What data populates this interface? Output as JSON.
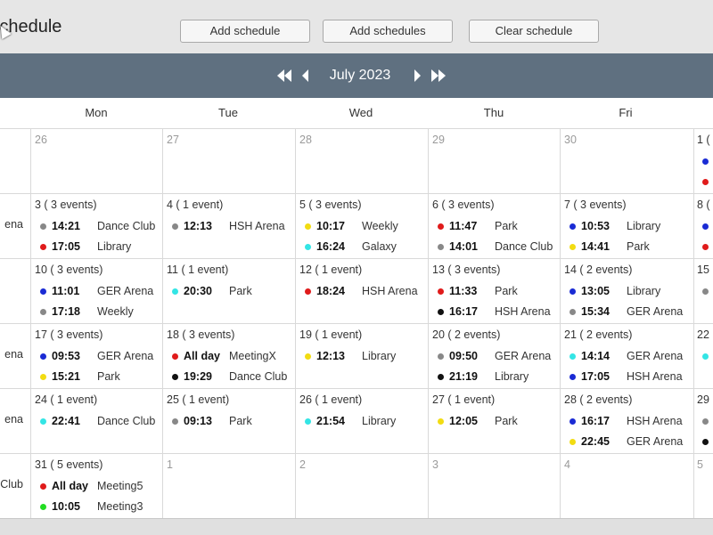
{
  "app": {
    "title": "Schedule"
  },
  "toolbar": {
    "add_label": "Add schedule",
    "add_multi_label": "Add schedules",
    "clear_label": "Clear schedule"
  },
  "nav": {
    "month_label": "July 2023"
  },
  "colors": {
    "nav_bg": "#5f7080",
    "blue": "#1a2bd4",
    "red": "#e01b1b",
    "gray": "#888888",
    "yellow": "#f2dc12",
    "cyan": "#33e5e5",
    "black": "#111111",
    "green": "#22dd22"
  },
  "weekdays": [
    "Mon",
    "Tue",
    "Wed",
    "Thu",
    "Fri"
  ],
  "weeks": [
    [
      {
        "date": "26",
        "muted": true,
        "events": []
      },
      {
        "date": "27",
        "muted": true,
        "events": []
      },
      {
        "date": "28",
        "muted": true,
        "events": []
      },
      {
        "date": "29",
        "muted": true,
        "events": []
      },
      {
        "date": "30",
        "muted": true,
        "events": []
      }
    ],
    [
      {
        "date": "3 ( 3 events)",
        "events": [
          {
            "color": "gray",
            "time": "14:21",
            "title": "Dance Club"
          },
          {
            "color": "red",
            "time": "17:05",
            "title": "Library"
          }
        ]
      },
      {
        "date": "4 ( 1 event)",
        "events": [
          {
            "color": "gray",
            "time": "12:13",
            "title": "HSH Arena"
          }
        ]
      },
      {
        "date": "5 ( 3 events)",
        "events": [
          {
            "color": "yellow",
            "time": "10:17",
            "title": "Weekly"
          },
          {
            "color": "cyan",
            "time": "16:24",
            "title": "Galaxy"
          }
        ]
      },
      {
        "date": "6 ( 3 events)",
        "events": [
          {
            "color": "red",
            "time": "11:47",
            "title": "Park"
          },
          {
            "color": "gray",
            "time": "14:01",
            "title": "Dance Club"
          }
        ]
      },
      {
        "date": "7 ( 3 events)",
        "events": [
          {
            "color": "blue",
            "time": "10:53",
            "title": "Library"
          },
          {
            "color": "yellow",
            "time": "14:41",
            "title": "Park"
          }
        ]
      }
    ],
    [
      {
        "date": "10 ( 3 events)",
        "events": [
          {
            "color": "blue",
            "time": "11:01",
            "title": "GER Arena"
          },
          {
            "color": "gray",
            "time": "17:18",
            "title": "Weekly"
          }
        ]
      },
      {
        "date": "11 ( 1 event)",
        "events": [
          {
            "color": "cyan",
            "time": "20:30",
            "title": "Park"
          }
        ]
      },
      {
        "date": "12 ( 1 event)",
        "events": [
          {
            "color": "red",
            "time": "18:24",
            "title": "HSH Arena"
          }
        ]
      },
      {
        "date": "13 ( 3 events)",
        "events": [
          {
            "color": "red",
            "time": "11:33",
            "title": "Park"
          },
          {
            "color": "black",
            "time": "16:17",
            "title": "HSH Arena"
          }
        ]
      },
      {
        "date": "14 ( 2 events)",
        "events": [
          {
            "color": "blue",
            "time": "13:05",
            "title": "Library"
          },
          {
            "color": "gray",
            "time": "15:34",
            "title": "GER Arena"
          }
        ]
      }
    ],
    [
      {
        "date": "17 ( 3 events)",
        "events": [
          {
            "color": "blue",
            "time": "09:53",
            "title": "GER Arena"
          },
          {
            "color": "yellow",
            "time": "15:21",
            "title": "Park"
          }
        ]
      },
      {
        "date": "18 ( 3 events)",
        "events": [
          {
            "color": "red",
            "time": "All day",
            "title": "MeetingX"
          },
          {
            "color": "black",
            "time": "19:29",
            "title": "Dance Club"
          }
        ]
      },
      {
        "date": "19 ( 1 event)",
        "events": [
          {
            "color": "yellow",
            "time": "12:13",
            "title": "Library"
          }
        ]
      },
      {
        "date": "20 ( 2 events)",
        "events": [
          {
            "color": "gray",
            "time": "09:50",
            "title": "GER Arena"
          },
          {
            "color": "black",
            "time": "21:19",
            "title": "Library"
          }
        ]
      },
      {
        "date": "21 ( 2 events)",
        "events": [
          {
            "color": "cyan",
            "time": "14:14",
            "title": "GER Arena"
          },
          {
            "color": "blue",
            "time": "17:05",
            "title": "HSH Arena"
          }
        ]
      }
    ],
    [
      {
        "date": "24 ( 1 event)",
        "events": [
          {
            "color": "cyan",
            "time": "22:41",
            "title": "Dance Club"
          }
        ]
      },
      {
        "date": "25 ( 1 event)",
        "events": [
          {
            "color": "gray",
            "time": "09:13",
            "title": "Park"
          }
        ]
      },
      {
        "date": "26 ( 1 event)",
        "events": [
          {
            "color": "cyan",
            "time": "21:54",
            "title": "Library"
          }
        ]
      },
      {
        "date": "27 ( 1 event)",
        "events": [
          {
            "color": "yellow",
            "time": "12:05",
            "title": "Park"
          }
        ]
      },
      {
        "date": "28 ( 2 events)",
        "events": [
          {
            "color": "blue",
            "time": "16:17",
            "title": "HSH Arena"
          },
          {
            "color": "yellow",
            "time": "22:45",
            "title": "GER Arena"
          }
        ]
      }
    ],
    [
      {
        "date": "31 ( 5 events)",
        "events": [
          {
            "color": "red",
            "time": "All day",
            "title": "Meeting5"
          },
          {
            "color": "green",
            "time": "10:05",
            "title": "Meeting3"
          }
        ]
      },
      {
        "date": "1",
        "muted": true,
        "events": []
      },
      {
        "date": "2",
        "muted": true,
        "events": []
      },
      {
        "date": "3",
        "muted": true,
        "events": []
      },
      {
        "date": "4",
        "muted": true,
        "events": []
      }
    ]
  ],
  "left_partial": [
    "",
    "ena",
    "",
    "ena",
    "ena",
    "Club"
  ],
  "right_partial": [
    {
      "date": "1 (",
      "dots": [
        "blue",
        "red"
      ]
    },
    {
      "date": "8 (",
      "dots": [
        "blue",
        "red"
      ]
    },
    {
      "date": "15",
      "dots": [
        "gray"
      ]
    },
    {
      "date": "22",
      "dots": [
        "cyan"
      ]
    },
    {
      "date": "29",
      "dots": [
        "gray",
        "black"
      ]
    },
    {
      "date": "5",
      "dots": []
    }
  ]
}
